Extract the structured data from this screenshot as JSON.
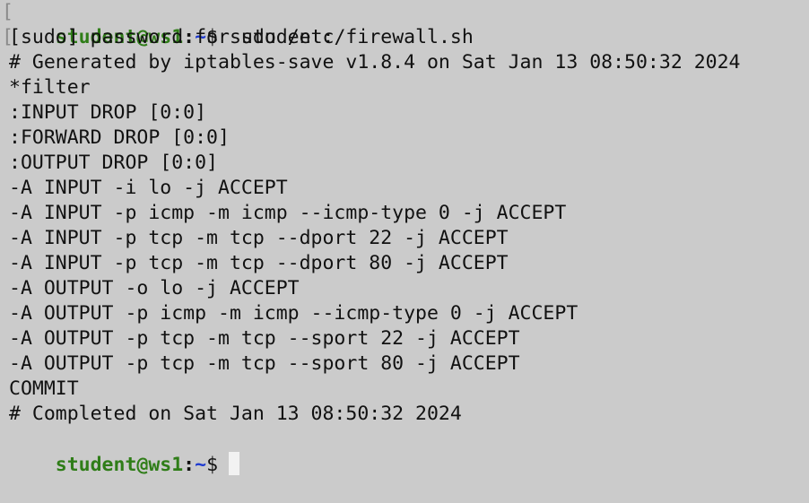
{
  "prompt": {
    "user_host": "student@ws1",
    "separator": ":",
    "path": "~",
    "symbol": "$"
  },
  "command": "sudo /etc/firewall.sh",
  "output_lines": [
    "[sudo] password for student:",
    "# Generated by iptables-save v1.8.4 on Sat Jan 13 08:50:32 2024",
    "*filter",
    ":INPUT DROP [0:0]",
    ":FORWARD DROP [0:0]",
    ":OUTPUT DROP [0:0]",
    "-A INPUT -i lo -j ACCEPT",
    "-A INPUT -p icmp -m icmp --icmp-type 0 -j ACCEPT",
    "-A INPUT -p tcp -m tcp --dport 22 -j ACCEPT",
    "-A INPUT -p tcp -m tcp --dport 80 -j ACCEPT",
    "-A OUTPUT -o lo -j ACCEPT",
    "-A OUTPUT -p icmp -m icmp --icmp-type 0 -j ACCEPT",
    "-A OUTPUT -p tcp -m tcp --sport 22 -j ACCEPT",
    "-A OUTPUT -p tcp -m tcp --sport 80 -j ACCEPT",
    "COMMIT",
    "# Completed on Sat Jan 13 08:50:32 2024"
  ],
  "colors": {
    "background": "#cbcbcb",
    "text": "#111111",
    "user_host": "#2f7d18",
    "path": "#1f3bd0",
    "cursor": "#f2f2f2"
  }
}
